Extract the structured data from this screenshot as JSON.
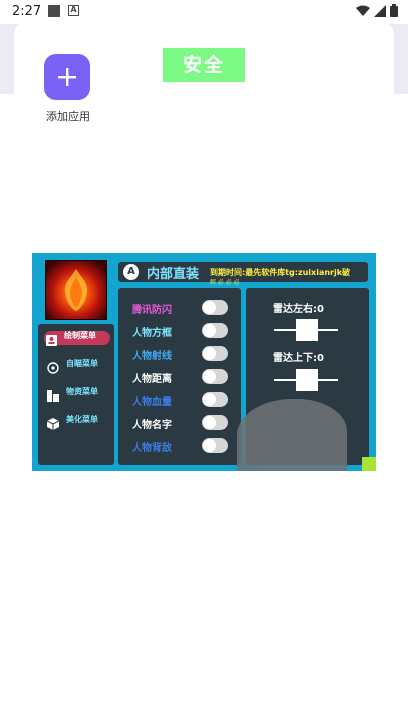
{
  "status_bar": {
    "time": "2:27",
    "notif_badge": "A"
  },
  "app": {
    "add_label": "添加应用",
    "safe_label": "安全"
  },
  "menu": {
    "title": "内部直装",
    "title_icon": "A",
    "subtitle": "到期时间:最先软件库tg:zuixianrjk破",
    "subtitle_cut": "解 必 必 必",
    "side_items": [
      {
        "label": "绘制菜单",
        "icon": "person-card-icon"
      },
      {
        "label": "自瞄菜单",
        "icon": "aim-icon"
      },
      {
        "label": "物资菜单",
        "icon": "supplies-icon"
      },
      {
        "label": "美化菜单",
        "icon": "cube-icon"
      }
    ],
    "features": [
      {
        "label": "腾讯防闪",
        "color": "#e65bd8"
      },
      {
        "label": "人物方框",
        "color": "#7ee3ff"
      },
      {
        "label": "人物射线",
        "color": "#3fa9f5"
      },
      {
        "label": "人物距离",
        "color": "#ffffff"
      },
      {
        "label": "人物血量",
        "color": "#3b7de8"
      },
      {
        "label": "人物名字",
        "color": "#ffffff"
      },
      {
        "label": "人物背敌",
        "color": "#3b7de8"
      }
    ],
    "radar_lr_label": "雷达左右:0",
    "radar_ud_label": "雷达上下:0"
  },
  "colors": {
    "accent": "#7a62f5",
    "safe": "#7dfa85",
    "menu_bg": "#13a4cf",
    "panel": "#2b3a42"
  }
}
